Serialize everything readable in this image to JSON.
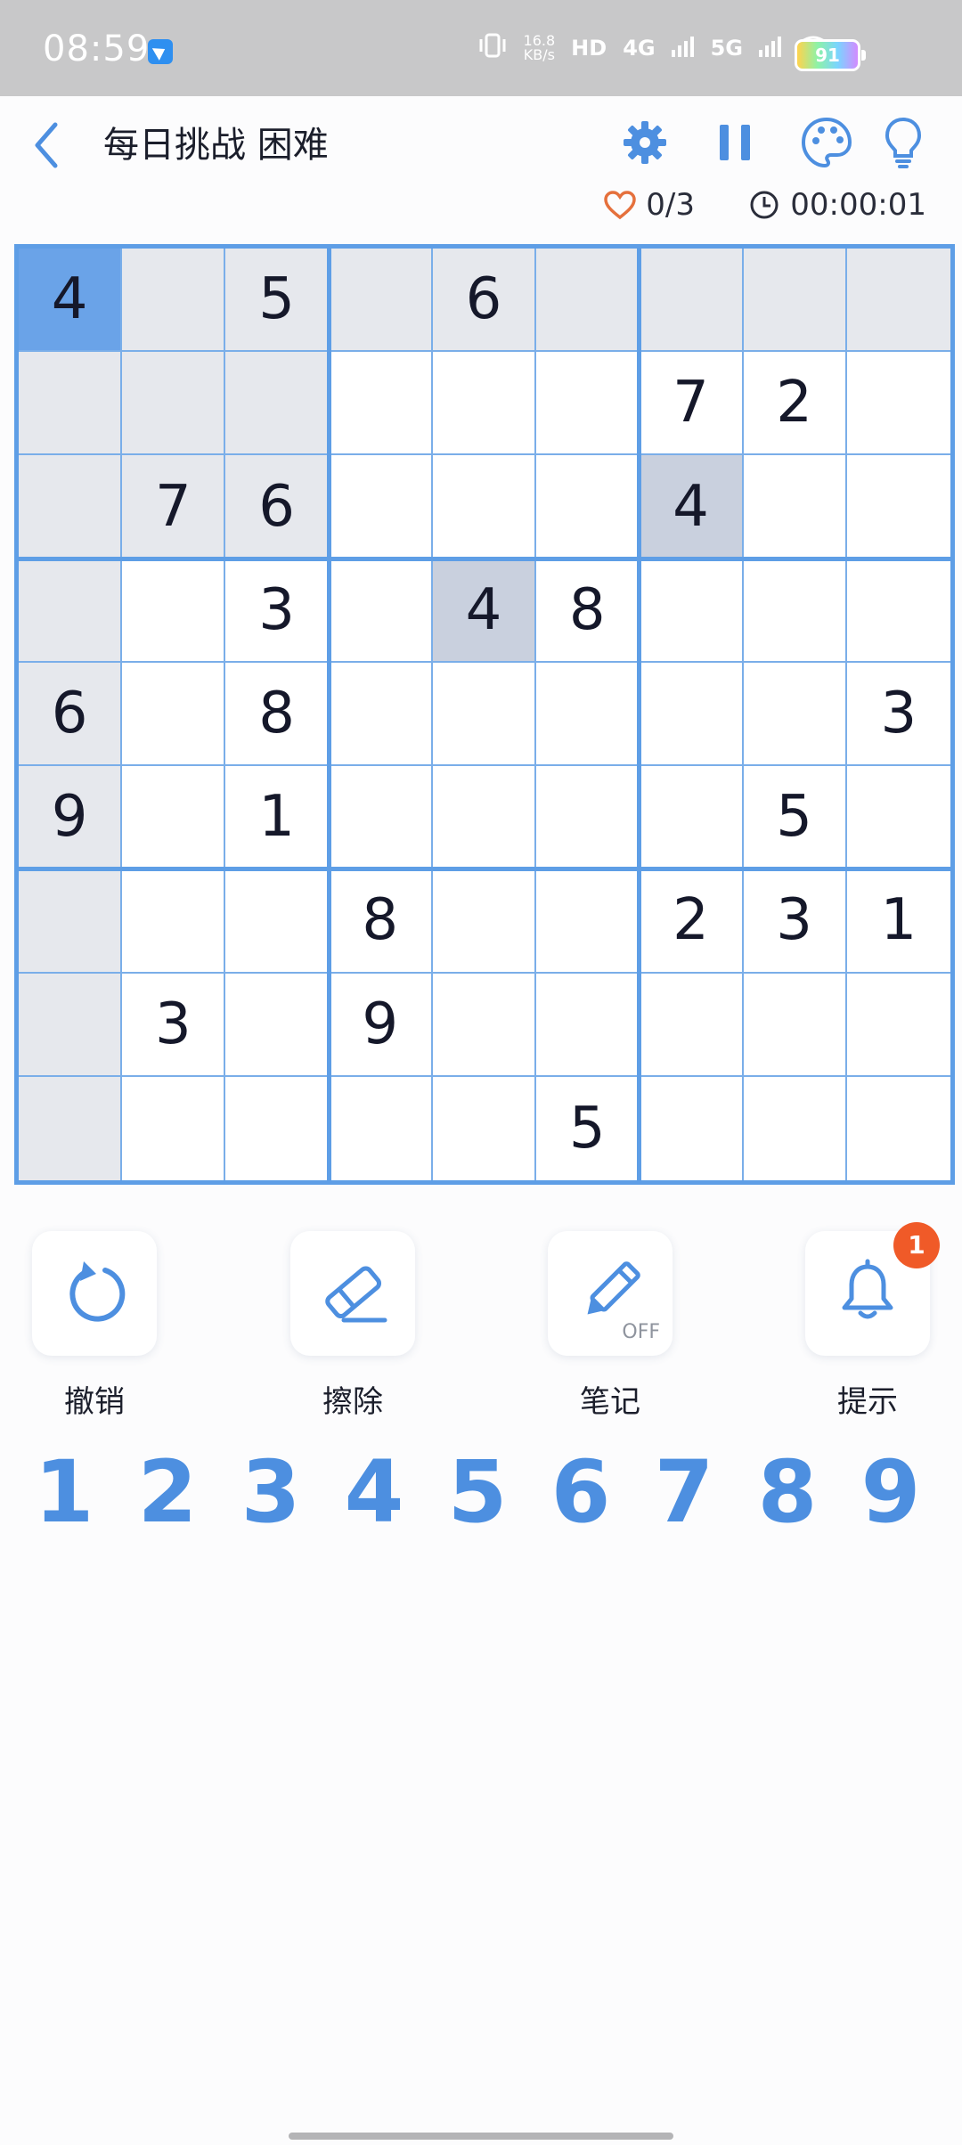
{
  "status_bar": {
    "time": "08:59",
    "speed_value": "16.8",
    "speed_unit": "KB/s",
    "hd_label": "HD",
    "net_4g": "4G",
    "net_5g": "5G",
    "battery": "91"
  },
  "header": {
    "title": "每日挑战 困难",
    "icons": [
      "back-icon",
      "settings-gear-icon",
      "pause-icon",
      "palette-icon",
      "lightbulb-icon"
    ]
  },
  "status": {
    "lives": "0/3",
    "timer": "00:00:01"
  },
  "colors": {
    "accent": "#5e9ee6",
    "selected_cell": "#6aa3e8",
    "highlight_cell": "#e6e8ed",
    "same_number_cell": "#c9d0de",
    "badge": "#f05a28"
  },
  "board": {
    "selected": [
      0,
      0
    ],
    "cells": [
      [
        "4",
        "",
        "5",
        "",
        "6",
        "",
        "",
        "",
        ""
      ],
      [
        "",
        "",
        "",
        "",
        "",
        "",
        "7",
        "2",
        ""
      ],
      [
        "",
        "7",
        "6",
        "",
        "",
        "",
        "4",
        "",
        ""
      ],
      [
        "",
        "",
        "3",
        "",
        "4",
        "8",
        "",
        "",
        ""
      ],
      [
        "6",
        "",
        "8",
        "",
        "",
        "",
        "",
        "",
        "3"
      ],
      [
        "9",
        "",
        "1",
        "",
        "",
        "",
        "",
        "5",
        ""
      ],
      [
        "",
        "",
        "",
        "8",
        "",
        "",
        "2",
        "3",
        "1"
      ],
      [
        "",
        "3",
        "",
        "9",
        "",
        "",
        "",
        "",
        ""
      ],
      [
        "",
        "",
        "",
        "",
        "",
        "5",
        "",
        "",
        ""
      ]
    ],
    "highlighted": [
      [
        0,
        1
      ],
      [
        0,
        2
      ],
      [
        0,
        3
      ],
      [
        0,
        4
      ],
      [
        0,
        5
      ],
      [
        0,
        6
      ],
      [
        0,
        7
      ],
      [
        0,
        8
      ],
      [
        1,
        0
      ],
      [
        1,
        1
      ],
      [
        1,
        2
      ],
      [
        2,
        0
      ],
      [
        2,
        1
      ],
      [
        2,
        2
      ],
      [
        3,
        0
      ],
      [
        4,
        0
      ],
      [
        5,
        0
      ],
      [
        6,
        0
      ],
      [
        7,
        0
      ],
      [
        8,
        0
      ]
    ],
    "same_number": [
      [
        2,
        6
      ],
      [
        3,
        4
      ]
    ]
  },
  "tools": {
    "undo": "撤销",
    "erase": "擦除",
    "notes": "笔记",
    "notes_state": "OFF",
    "hint": "提示",
    "hint_count": "1"
  },
  "numpad": [
    "1",
    "2",
    "3",
    "4",
    "5",
    "6",
    "7",
    "8",
    "9"
  ]
}
